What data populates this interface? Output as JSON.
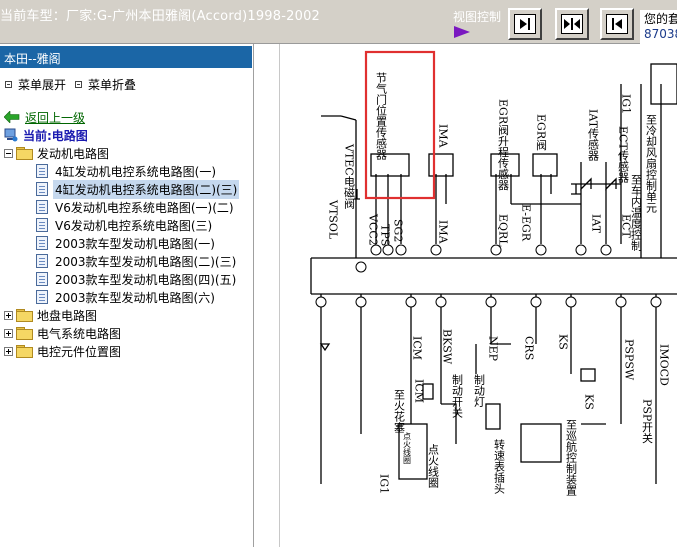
{
  "header": {
    "car_title": "当前车型：厂家:G-广州本田雅阁(Accord)1998-2002",
    "view_control_label": "视图控制",
    "user_line1": "您的套",
    "user_line2": "87038"
  },
  "left_pane": {
    "title": "本田--雅阁",
    "expand_all": "菜单展开",
    "collapse_all": "菜单折叠"
  },
  "tree": {
    "back": "返回上一级",
    "current": "当前:电路图",
    "engine_folder": "发动机电路图",
    "items": [
      "4缸发动机电控系统电路图(一)",
      "4缸发动机电控系统电路图(二)(三)",
      "V6发动机电控系统电路图(一)(二)",
      "V6发动机电控系统电路图(三)",
      "2003款车型发动机电路图(一)",
      "2003款车型发动机电路图(二)(三)",
      "2003款车型发动机电路图(四)(五)",
      "2003款车型发动机电路图(六)"
    ],
    "chassis_folder": "地盘电路图",
    "electrical_folder": "电气系统电路图",
    "component_folder": "电控元件位置图"
  },
  "diagram": {
    "throttle_sensor": "节气门位置传感器",
    "egr_lift_sensor": "EGR阀升程传感器",
    "egr_valve": "EGR阀",
    "iat_sensor": "IAT传感器",
    "ect_sensor": "ECT传感器",
    "iat_label": "IAT",
    "ect_label": "ECT",
    "vtec_valve": "VTEC电磁阀",
    "vtsol": "VTSOL",
    "vcc2": "VCC2",
    "tps": "TPS",
    "sg2": "SG2",
    "ima_top": "IMA",
    "ima_bottom": "IMA",
    "eqrl": "EQRL",
    "e_egr": "E-EGR",
    "ig1_top": "IG1",
    "radiator_fan": "至冷却风扇控制单元",
    "temp_gauge": "至车内温度控制",
    "icm": "ICM",
    "bksw": "BKSW",
    "nep": "NEP",
    "crs": "CRS",
    "ks_top": "KS",
    "pspsw": "PSPSW",
    "imocd": "IMOCD",
    "brake_switch": "制动开关",
    "brake_light": "制动灯",
    "igniter": "至火花塞",
    "ignition_coil": "点火线圈",
    "ignition_coil_label": "点火线圈",
    "tach_connector": "转速表插头",
    "cruise_unit": "至巡航控制装置",
    "ks_bottom": "KS",
    "psp_switch": "PSP开关",
    "ig1_bottom": "IG1",
    "box_label": "ICM"
  }
}
